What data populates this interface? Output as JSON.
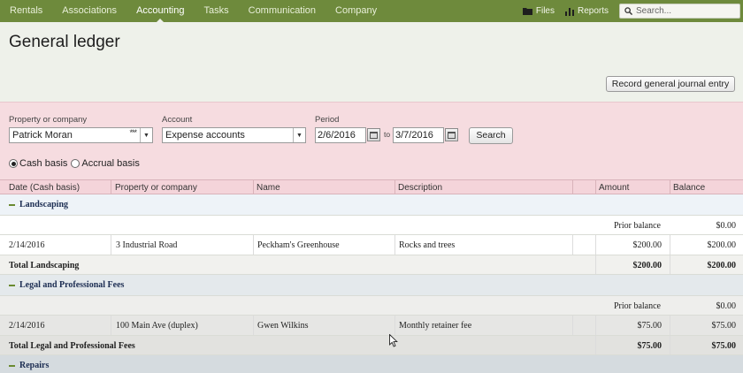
{
  "nav": {
    "items": [
      {
        "label": "Rentals",
        "active": false
      },
      {
        "label": "Associations",
        "active": false
      },
      {
        "label": "Accounting",
        "active": true
      },
      {
        "label": "Tasks",
        "active": false
      },
      {
        "label": "Communication",
        "active": false
      },
      {
        "label": "Company",
        "active": false
      }
    ],
    "files_label": "Files",
    "reports_label": "Reports",
    "search_placeholder": "Search...",
    "icons": {
      "files": "folder-icon",
      "reports": "bar-chart-icon",
      "search": "search-icon"
    },
    "colors": {
      "bar": "#6e8a3c"
    }
  },
  "page": {
    "title": "General ledger",
    "record_button": "Record general journal entry"
  },
  "filters": {
    "property_label": "Property or company",
    "property_value": "Patrick Moran",
    "property_dots": "***",
    "account_label": "Account",
    "account_value": "Expense accounts",
    "period_label": "Period",
    "period_from": "2/6/2016",
    "period_to_label": "to",
    "period_to": "3/7/2016",
    "search_button": "Search",
    "basis": {
      "cash_label": "Cash basis",
      "accrual_label": "Accrual basis",
      "selected": "cash"
    },
    "colors": {
      "panel": "#f6dce0"
    }
  },
  "table": {
    "headers": {
      "date": "Date (Cash basis)",
      "property": "Property or company",
      "name": "Name",
      "description": "Description",
      "amount": "Amount",
      "balance": "Balance"
    },
    "groups": [
      {
        "name": "Landscaping",
        "prior_label": "Prior balance",
        "prior_balance": "$0.00",
        "rows": [
          {
            "date": "2/14/2016",
            "property": "3 Industrial Road",
            "name": "Peckham's Greenhouse",
            "description": "Rocks and trees",
            "amount": "$200.00",
            "balance": "$200.00"
          }
        ],
        "total_label": "Total Landscaping",
        "total_amount": "$200.00",
        "total_balance": "$200.00"
      },
      {
        "name": "Legal and Professional Fees",
        "prior_label": "Prior balance",
        "prior_balance": "$0.00",
        "rows": [
          {
            "date": "2/14/2016",
            "property": "100 Main Ave (duplex)",
            "name": "Gwen Wilkins",
            "description": "Monthly retainer fee",
            "amount": "$75.00",
            "balance": "$75.00"
          }
        ],
        "total_label": "Total Legal and Professional Fees",
        "total_amount": "$75.00",
        "total_balance": "$75.00"
      },
      {
        "name": "Repairs"
      }
    ]
  }
}
